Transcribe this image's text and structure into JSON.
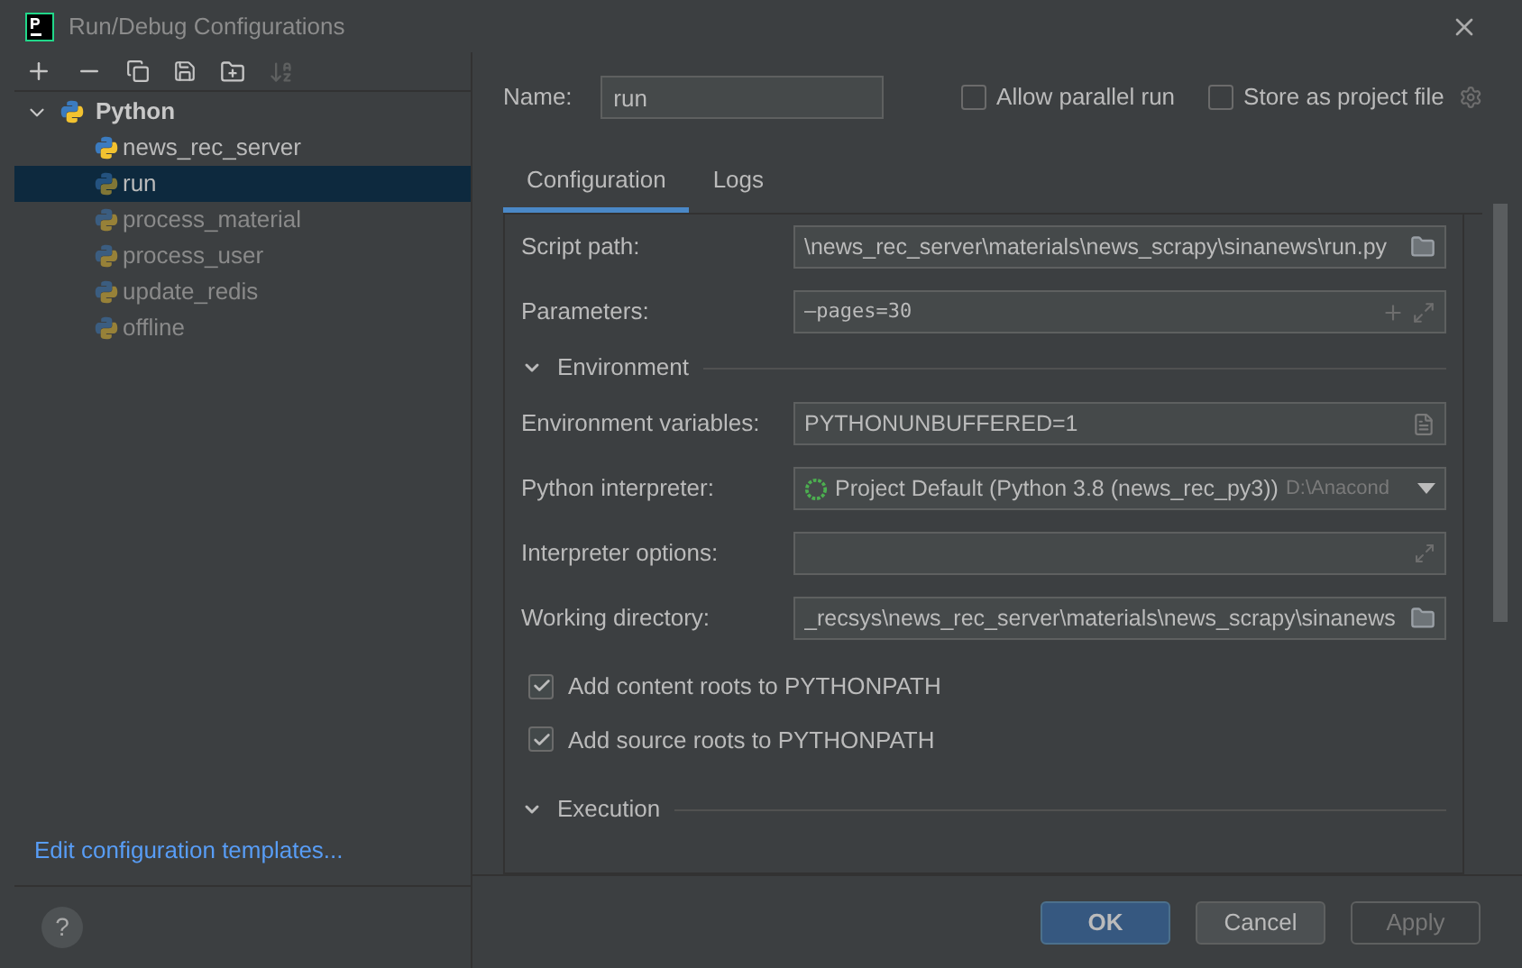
{
  "window": {
    "title": "Run/Debug Configurations"
  },
  "tree": {
    "label": "Python",
    "expanded": true,
    "children": [
      {
        "label": "news_rec_server",
        "selected": false,
        "temporary": false
      },
      {
        "label": "run",
        "selected": true,
        "temporary": true
      },
      {
        "label": "process_material",
        "selected": false,
        "temporary": true
      },
      {
        "label": "process_user",
        "selected": false,
        "temporary": true
      },
      {
        "label": "update_redis",
        "selected": false,
        "temporary": true
      },
      {
        "label": "offline",
        "selected": false,
        "temporary": true
      }
    ]
  },
  "templates_link": "Edit configuration templates...",
  "name_field": {
    "label": "Name:",
    "value": "run"
  },
  "options": [
    {
      "label": "Allow parallel run",
      "checked": false
    },
    {
      "label": "Store as project file",
      "checked": false
    }
  ],
  "tabs": [
    {
      "label": "Configuration",
      "selected": true
    },
    {
      "label": "Logs",
      "selected": false
    }
  ],
  "script_path": {
    "label": "Script path:",
    "value": "\\news_rec_server\\materials\\news_scrapy\\sinanews\\run.py"
  },
  "parameters": {
    "label": "Parameters:",
    "value": "—pages=30"
  },
  "sections": [
    {
      "title": "Environment",
      "expanded": true
    },
    {
      "title": "Execution",
      "expanded": true
    }
  ],
  "env_vars": {
    "label": "Environment variables:",
    "value": "PYTHONUNBUFFERED=1"
  },
  "interpreter": {
    "label": "Python interpreter:",
    "value": "Project Default (Python 3.8 (news_rec_py3))",
    "path": "D:\\Anacond"
  },
  "interpreter_options": {
    "label": "Interpreter options:"
  },
  "working_dir": {
    "label": "Working directory:",
    "value": "_recsys\\news_rec_server\\materials\\news_scrapy\\sinanews"
  },
  "path_checks": [
    {
      "label": "Add content roots to PYTHONPATH",
      "checked": true
    },
    {
      "label": "Add source roots to PYTHONPATH",
      "checked": true
    }
  ],
  "help": "?",
  "buttons": [
    {
      "label": "OK",
      "kind": "default",
      "disabled": false
    },
    {
      "label": "Cancel",
      "kind": "normal",
      "disabled": false
    },
    {
      "label": "Apply",
      "kind": "normal",
      "disabled": true
    }
  ]
}
